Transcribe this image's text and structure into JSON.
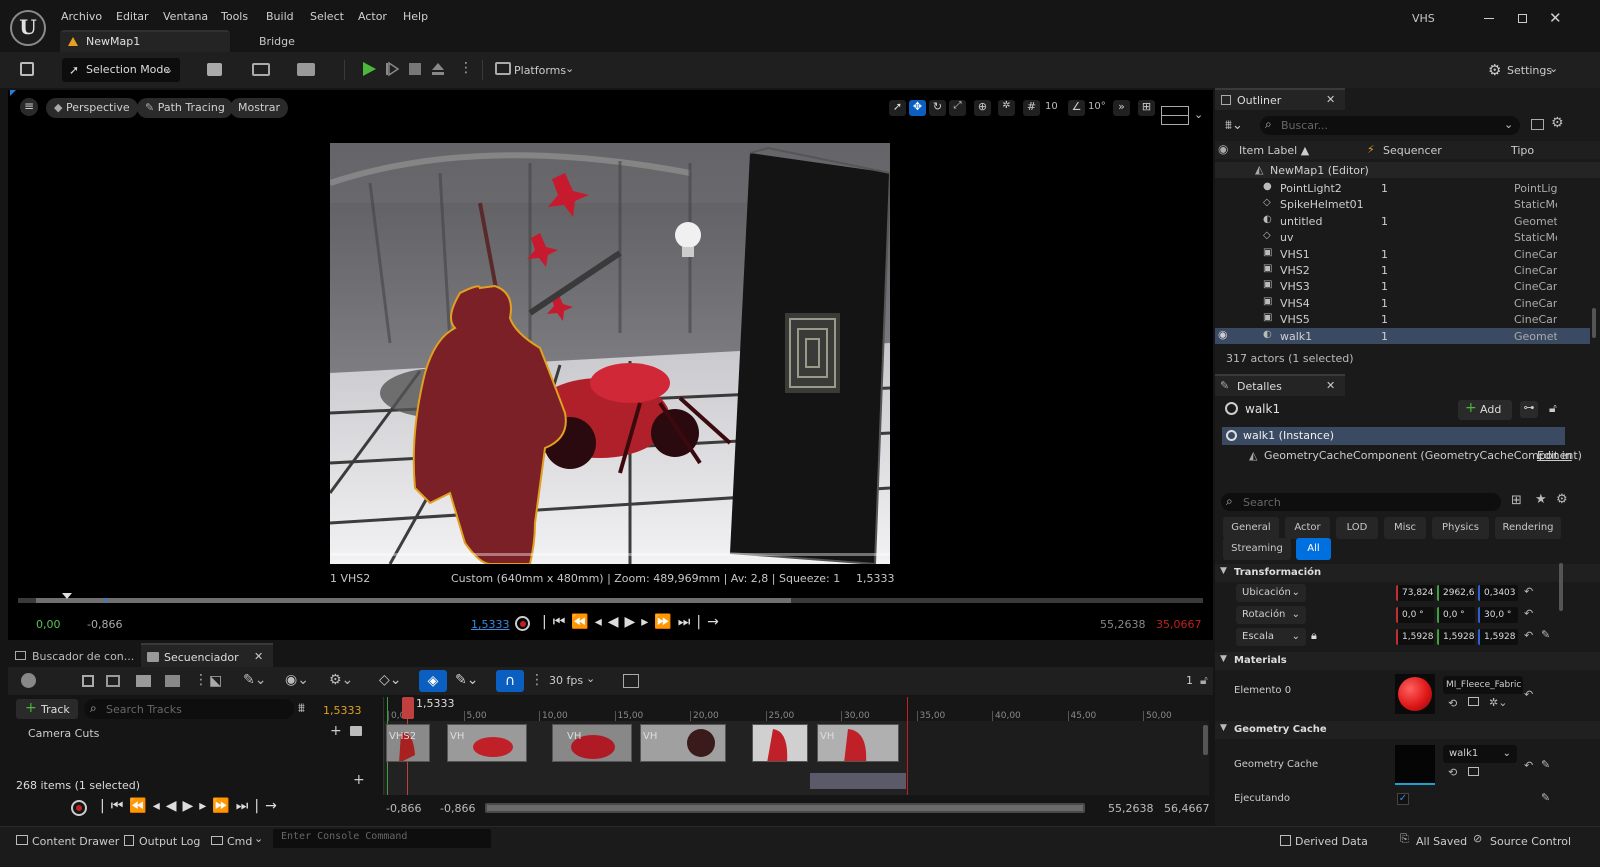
{
  "menu": {
    "items": [
      "Archivo",
      "Editar",
      "Ventana",
      "Tools",
      "Build",
      "Select",
      "Actor",
      "Help"
    ],
    "project": "VHS",
    "map_tab": "NewMap1",
    "bridge": "Bridge"
  },
  "toolbar": {
    "selection_mode": "Selection Mode",
    "platforms": "Platforms",
    "settings": "Settings"
  },
  "viewport": {
    "perspective": "Perspective",
    "path_tracing": "Path Tracing",
    "mostrar": "Mostrar",
    "grid_value": "10",
    "angle_value": "10°",
    "camera_label": "1 VHS2",
    "camera_info": "Custom (640mm x 480mm) | Zoom: 489,969mm | Av: 2,8 | Squeeze: 1",
    "camera_time": "1,5333",
    "playback": {
      "start": "0,00",
      "offset": "-0,866",
      "current": "1,5333",
      "end_range": "55,2638",
      "end_red": "35,0667"
    }
  },
  "bottom_tabs": {
    "content": "Buscador de con...",
    "sequencer": "Secuenciador"
  },
  "sequencer": {
    "fps": "30 fps",
    "track_button": "Track",
    "search_placeholder": "Search Tracks",
    "time": "1,5333",
    "playhead_label": "1,5333",
    "count_right": "1",
    "ticks": [
      "0,00",
      "5,00",
      "10,00",
      "15,00",
      "20,00",
      "25,00",
      "30,00",
      "35,00",
      "40,00",
      "45,00",
      "50,00"
    ],
    "track_camera_cuts": "Camera Cuts",
    "clips": [
      "VHS2",
      "VH",
      "VH",
      "VH",
      "VH"
    ],
    "items_count": "268 items (1 selected)",
    "footer": {
      "left_a": "-0,866",
      "left_b": "-0,866",
      "right_a": "55,2638",
      "right_b": "56,4667"
    }
  },
  "status": {
    "content_drawer": "Content Drawer",
    "output_log": "Output Log",
    "cmd": "Cmd",
    "console_placeholder": "Enter Console Command",
    "derived_data": "Derived Data",
    "all_saved": "All Saved",
    "source_control": "Source Control"
  },
  "outliner": {
    "title": "Outliner",
    "search_placeholder": "Buscar...",
    "columns": {
      "label": "Item Label ▲",
      "sequencer": "Sequencer",
      "tipo": "Tipo"
    },
    "root": "NewMap1 (Editor)",
    "rows": [
      {
        "name": "PointLight2",
        "seq": "1",
        "type": "PointLigh"
      },
      {
        "name": "SpikeHelmet01",
        "seq": "",
        "type": "StaticMes"
      },
      {
        "name": "untitled",
        "seq": "1",
        "type": "Geometry"
      },
      {
        "name": "uv",
        "seq": "",
        "type": "StaticMes"
      },
      {
        "name": "VHS1",
        "seq": "1",
        "type": "CineCame"
      },
      {
        "name": "VHS2",
        "seq": "1",
        "type": "CineCame"
      },
      {
        "name": "VHS3",
        "seq": "1",
        "type": "CineCame"
      },
      {
        "name": "VHS4",
        "seq": "1",
        "type": "CineCame"
      },
      {
        "name": "VHS5",
        "seq": "1",
        "type": "CineCame"
      },
      {
        "name": "walk1",
        "seq": "1",
        "type": "Geometry"
      }
    ],
    "footer": "317 actors (1 selected)"
  },
  "details": {
    "title": "Detalles",
    "object": "walk1",
    "add": "Add",
    "instance": "walk1 (Instance)",
    "component": "GeometryCacheComponent (GeometryCacheComponent)",
    "edit_link": "Edit in",
    "search_placeholder": "Search",
    "filters": [
      "General",
      "Actor",
      "LOD",
      "Misc",
      "Physics",
      "Rendering",
      "Streaming",
      "All"
    ],
    "transform": {
      "section": "Transformación",
      "location": {
        "label": "Ubicación",
        "x": "73,824",
        "y": "2962,6",
        "z": "0,3403"
      },
      "rotation": {
        "label": "Rotación",
        "x": "0,0 °",
        "y": "0,0 °",
        "z": "30,0 °"
      },
      "scale": {
        "label": "Escala",
        "x": "1,5928",
        "y": "1,5928",
        "z": "1,5928"
      }
    },
    "materials": {
      "section": "Materials",
      "element_label": "Elemento 0",
      "material": "MI_Fleece_Fabric"
    },
    "geometry_cache": {
      "section": "Geometry Cache",
      "label": "Geometry Cache",
      "value": "walk1",
      "running_label": "Ejecutando",
      "running": true
    },
    "colors": {
      "accent": "#0070e0",
      "selection": "#3a4a63",
      "material_sphere": "#e01818",
      "recording_red": "#c02020"
    }
  }
}
